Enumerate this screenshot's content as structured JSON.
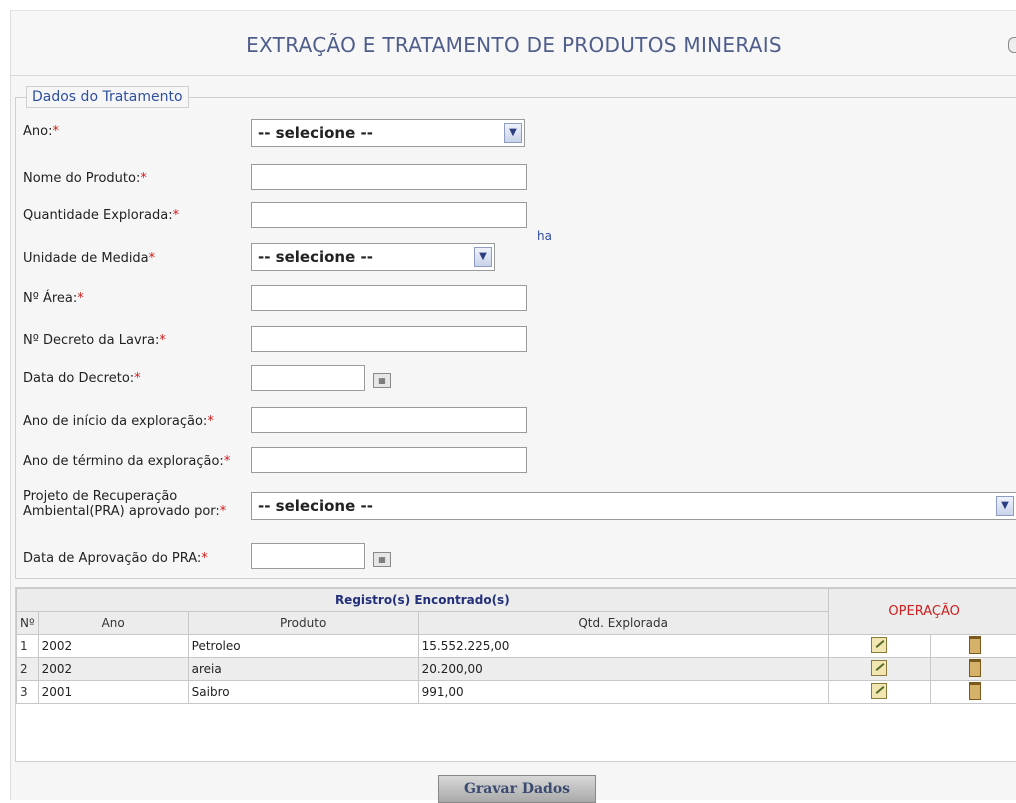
{
  "page": {
    "title": "EXTRAÇÃO E TRATAMENTO DE PRODUTOS MINERAIS"
  },
  "form": {
    "legend": "Dados do Tratamento",
    "required_mark": "*",
    "fields": {
      "ano": {
        "label": "Ano:",
        "value": "-- selecione --"
      },
      "nome_produto": {
        "label": "Nome do Produto:",
        "value": ""
      },
      "quantidade": {
        "label": "Quantidade Explorada:",
        "value": ""
      },
      "unidade": {
        "label": "Unidade de Medida",
        "value": "-- selecione --"
      },
      "area": {
        "label": "Nº Área:",
        "value": "",
        "unit": "ha"
      },
      "decreto_lavra": {
        "label": "Nº Decreto da Lavra:",
        "value": ""
      },
      "data_decreto": {
        "label": "Data do Decreto:",
        "value": ""
      },
      "ano_inicio": {
        "label": "Ano de início da exploração:",
        "value": ""
      },
      "ano_termino": {
        "label": "Ano de término da exploração:",
        "value": ""
      },
      "pra": {
        "label_line1": "Projeto de Recuperação",
        "label_line2": "Ambiental(PRA) aprovado por:",
        "value": "-- selecione --"
      },
      "data_pra": {
        "label": "Data de Aprovação do PRA:",
        "value": ""
      }
    }
  },
  "grid": {
    "caption": "Registro(s) Encontrado(s)",
    "operation_header": "OPERAÇÃO",
    "columns": [
      "Nº",
      "Ano",
      "Produto",
      "Qtd. Explorada"
    ],
    "rows": [
      {
        "num": "1",
        "ano": "2002",
        "produto": "Petroleo",
        "qtd": "15.552.225,00"
      },
      {
        "num": "2",
        "ano": "2002",
        "produto": "areia",
        "qtd": "20.200,00"
      },
      {
        "num": "3",
        "ano": "2001",
        "produto": "Saibro",
        "qtd": "991,00"
      }
    ]
  },
  "actions": {
    "save_label": "Gravar Dados"
  },
  "icons": {
    "select_arrow": "chevron-down-icon",
    "calendar": "calendar-icon",
    "edit": "edit-icon",
    "delete": "trash-icon"
  }
}
